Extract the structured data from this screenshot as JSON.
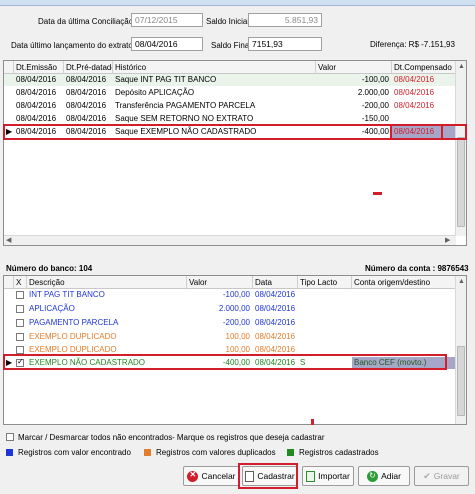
{
  "colors": {
    "blue": "#1f36d6",
    "orange": "#e47d2a",
    "green": "#1f8a1f",
    "red": "#d11e2a",
    "selected_bg": "#a6a6c8"
  },
  "header": {
    "data_ultima_conciliacao_label": "Data da última Conciliação:",
    "data_ultima_conciliacao": "07/12/2015",
    "saldo_inicial_label": "Saldo Inicial:",
    "saldo_inicial": "5.851,93",
    "data_ultimo_lancamento_label": "Data último lançamento do extrato:",
    "data_ultimo_lancamento": "08/04/2016",
    "saldo_final_label": "Saldo Final:",
    "saldo_final": "7151,93",
    "diferenca": "Diferença: R$ -7.151,93"
  },
  "top_grid": {
    "columns": [
      "Dt.Emissão",
      "Dt.Pré-datado",
      "Histórico",
      "Valor",
      "Dt.Compensado"
    ],
    "rows": [
      {
        "emissao": "08/04/2016",
        "predatado": "08/04/2016",
        "historico": "Saque INT PAG TIT BANCO",
        "valor": "-100,00",
        "compensado": "08/04/2016"
      },
      {
        "emissao": "08/04/2016",
        "predatado": "08/04/2016",
        "historico": "Depósito APLICAÇÃO",
        "valor": "2.000,00",
        "compensado": "08/04/2016"
      },
      {
        "emissao": "08/04/2016",
        "predatado": "08/04/2016",
        "historico": "Transferência PAGAMENTO PARCELA",
        "valor": "-200,00",
        "compensado": "08/04/2016"
      },
      {
        "emissao": "08/04/2016",
        "predatado": "08/04/2016",
        "historico": "Saque SEM RETORNO NO EXTRATO",
        "valor": "-150,00",
        "compensado": ""
      },
      {
        "emissao": "08/04/2016",
        "predatado": "08/04/2016",
        "historico": "Saque EXEMPLO NÃO CADASTRADO",
        "valor": "-400,00",
        "compensado": "08/04/2016"
      }
    ]
  },
  "bank_info": {
    "numero_banco": "Número do banco: 104",
    "numero_conta": "Número da conta : 9876543"
  },
  "bottom_grid": {
    "columns": [
      "X",
      "Descrição",
      "Valor",
      "Data",
      "Tipo Lacto",
      "Conta origem/destino"
    ],
    "rows": [
      {
        "descricao": "INT PAG TIT BANCO",
        "valor": "-100,00",
        "data": "08/04/2016",
        "tipo": "",
        "conta": "",
        "checked": false
      },
      {
        "descricao": "APLICAÇÃO",
        "valor": "2.000,00",
        "data": "08/04/2016",
        "tipo": "",
        "conta": "",
        "checked": false
      },
      {
        "descricao": "PAGAMENTO PARCELA",
        "valor": "-200,00",
        "data": "08/04/2016",
        "tipo": "",
        "conta": "",
        "checked": false
      },
      {
        "descricao": "EXEMPLO DUPLICADO",
        "valor": "100,00",
        "data": "08/04/2016",
        "tipo": "",
        "conta": "",
        "checked": false
      },
      {
        "descricao": "EXEMPLO DUPLICADO",
        "valor": "100,00",
        "data": "08/04/2016",
        "tipo": "",
        "conta": "",
        "checked": false
      },
      {
        "descricao": "EXEMPLO NÃO CADASTRADO",
        "valor": "-400,00",
        "data": "08/04/2016",
        "tipo": "S",
        "conta": "Banco CEF (movto.)",
        "checked": true
      }
    ]
  },
  "footer": {
    "marcar_label": "Marcar / Desmarcar todos não encontrados",
    "marcar_hint": "- Marque os registros que deseja cadastrar",
    "legend": [
      {
        "label": "Registros com valor encontrado",
        "color": "#1f36d6"
      },
      {
        "label": "Registros com valores duplicados",
        "color": "#e47d2a"
      },
      {
        "label": "Registros cadastrados",
        "color": "#1f8a1f"
      }
    ]
  },
  "buttons": {
    "cancelar": "Cancelar",
    "cadastrar": "Cadastrar",
    "importar": "Importar",
    "adiar": "Adiar",
    "gravar": "Gravar"
  }
}
